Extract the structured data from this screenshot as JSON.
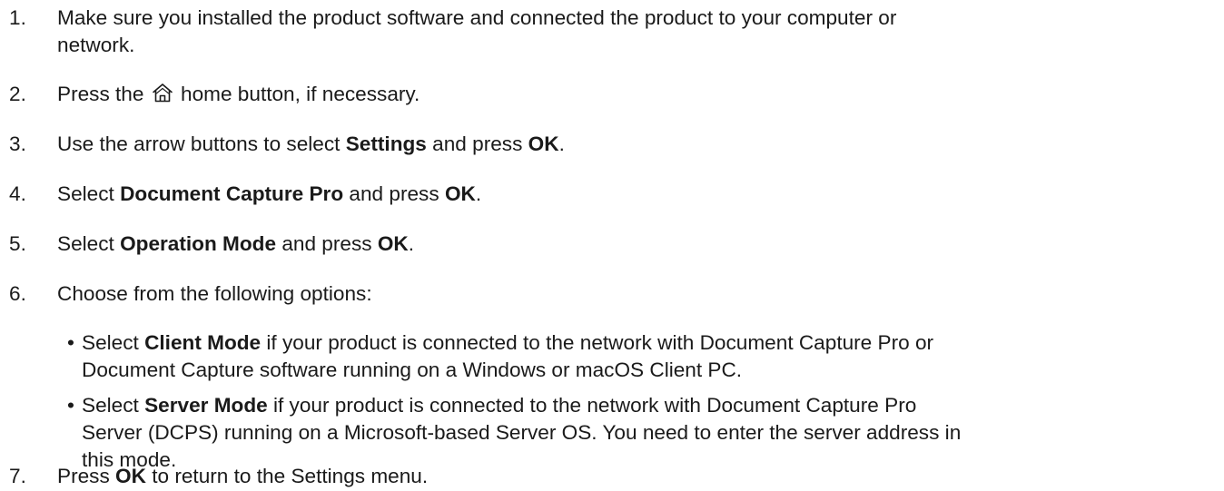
{
  "steps": [
    {
      "number": "1.",
      "line1": "Make sure you installed the product software and connected the product to your computer or",
      "line2": "network."
    },
    {
      "number": "2.",
      "before": "Press the",
      "icon": "home-icon",
      "after": "home button, if necessary."
    },
    {
      "number": "3.",
      "before": "Use the arrow buttons to select",
      "bold1": "Settings",
      "middle": "and press",
      "bold2": "OK",
      "end": "."
    },
    {
      "number": "4.",
      "before": "Select",
      "bold1": "Document Capture Pro",
      "middle": "and press",
      "bold2": "OK",
      "end": "."
    },
    {
      "number": "5.",
      "before": "Select",
      "bold1": "Operation Mode",
      "middle": "and press",
      "bold2": "OK",
      "end": "."
    },
    {
      "number": "6.",
      "text": "Choose from the following options:",
      "options": [
        {
          "bullet": "•",
          "before": "Select",
          "bold": "Client Mode",
          "line1_rest": "if your product is connected to the network with Document Capture Pro or",
          "line2": "Document Capture software running on a Windows or macOS Client PC."
        },
        {
          "bullet": "•",
          "before": "Select",
          "bold": "Server Mode",
          "line1_rest": "if your product is connected to the network with Document Capture Pro",
          "line2": "Server (DCPS) running on a Microsoft-based Server OS. You need to enter the server address in",
          "line3": "this mode."
        }
      ]
    },
    {
      "number": "7.",
      "before": "Press",
      "bold1": "OK",
      "after": "to return to the Settings menu."
    }
  ]
}
